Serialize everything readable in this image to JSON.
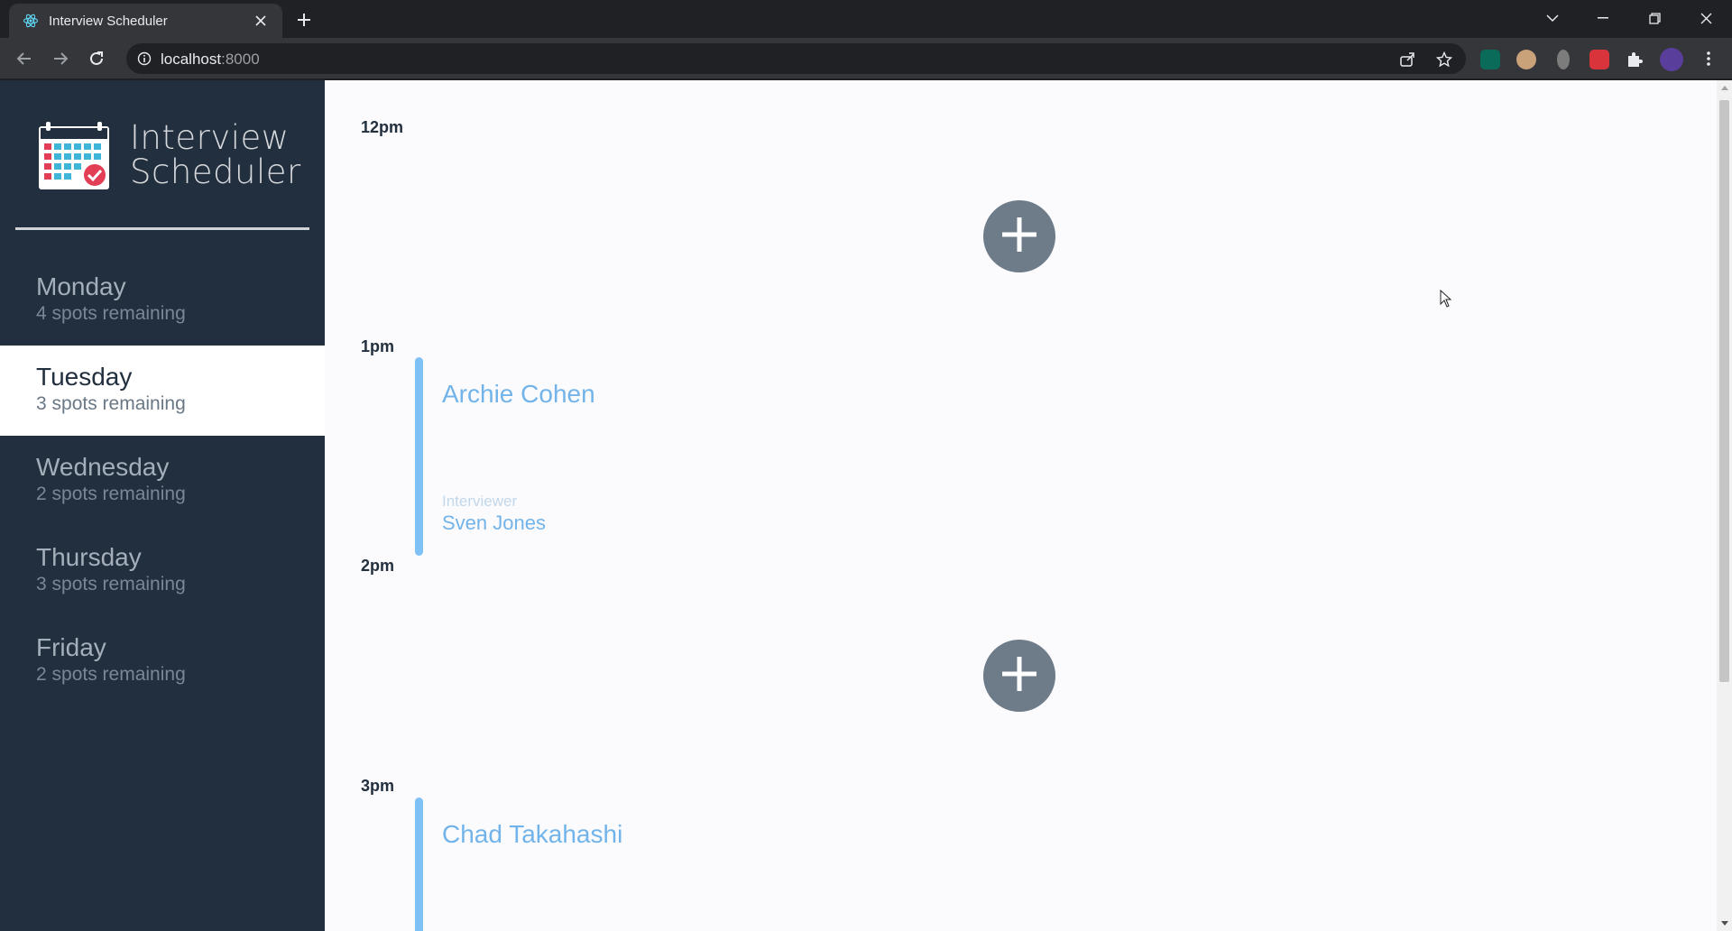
{
  "browser": {
    "tab_title": "Interview Scheduler",
    "url_host": "localhost",
    "url_port": ":8000"
  },
  "app": {
    "brand_line1": "Interview",
    "brand_line2": "Scheduler"
  },
  "days": [
    {
      "name": "Monday",
      "spots": "4 spots remaining",
      "selected": false
    },
    {
      "name": "Tuesday",
      "spots": "3 spots remaining",
      "selected": true
    },
    {
      "name": "Wednesday",
      "spots": "2 spots remaining",
      "selected": false
    },
    {
      "name": "Thursday",
      "spots": "3 spots remaining",
      "selected": false
    },
    {
      "name": "Friday",
      "spots": "2 spots remaining",
      "selected": false
    }
  ],
  "schedule": {
    "times": [
      "12pm",
      "1pm",
      "2pm",
      "3pm"
    ],
    "appointments": [
      {
        "student": "Archie Cohen",
        "interviewer_label": "Interviewer",
        "interviewer": "Sven Jones"
      },
      {
        "student": "Chad Takahashi"
      }
    ]
  },
  "colors": {
    "sidebar_bg": "#222f3e",
    "accent": "#7ec1f6",
    "add_button": "#6e7b89"
  }
}
